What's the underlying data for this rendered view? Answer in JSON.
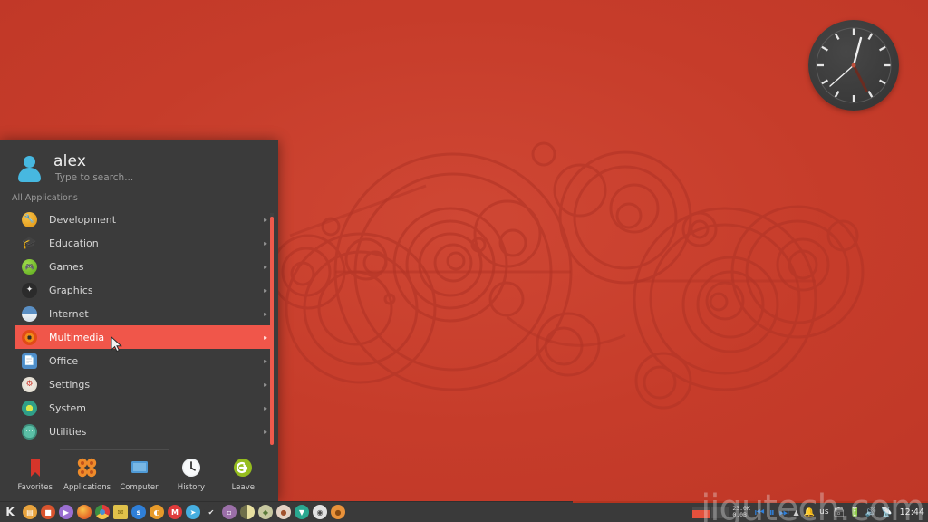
{
  "desktop": {
    "wallpaper_name": "gallifreyan-circles-wallpaper",
    "background_color": "#c8402e",
    "pattern_color": "#b8382a"
  },
  "clock_widget": {
    "name": "analog-clock-widget",
    "face_color": "#3b3b3b",
    "hand_color": "#e8e8e8",
    "second_hand_color": "#b03a2a",
    "time": "12:44"
  },
  "kickoff_menu": {
    "user": {
      "name": "alex",
      "search_placeholder": "Type to search..."
    },
    "section_label": "All Applications",
    "categories": [
      {
        "label": "Development",
        "icon": "development-icon",
        "arrow": "▸",
        "selected": false
      },
      {
        "label": "Education",
        "icon": "education-icon",
        "arrow": "▸",
        "selected": false
      },
      {
        "label": "Games",
        "icon": "games-icon",
        "arrow": "▸",
        "selected": false
      },
      {
        "label": "Graphics",
        "icon": "graphics-icon",
        "arrow": "▸",
        "selected": false
      },
      {
        "label": "Internet",
        "icon": "internet-icon",
        "arrow": "▸",
        "selected": false
      },
      {
        "label": "Multimedia",
        "icon": "multimedia-icon",
        "arrow": "▸",
        "selected": true
      },
      {
        "label": "Office",
        "icon": "office-icon",
        "arrow": "▸",
        "selected": false
      },
      {
        "label": "Settings",
        "icon": "settings-icon",
        "arrow": "▸",
        "selected": false
      },
      {
        "label": "System",
        "icon": "system-icon",
        "arrow": "▸",
        "selected": false
      },
      {
        "label": "Utilities",
        "icon": "utilities-icon",
        "arrow": "▸",
        "selected": false
      }
    ],
    "highlight_color": "#f0564a",
    "panel_color": "#3b3b3b",
    "tabs": [
      {
        "label": "Favorites",
        "icon": "bookmark-icon"
      },
      {
        "label": "Applications",
        "icon": "applications-grid-icon"
      },
      {
        "label": "Computer",
        "icon": "monitor-icon"
      },
      {
        "label": "History",
        "icon": "clock-icon"
      },
      {
        "label": "Leave",
        "icon": "power-logout-icon"
      }
    ],
    "active_tab": "Applications"
  },
  "taskbar": {
    "launcher": {
      "label": "K",
      "icon": "kde-kickoff-icon"
    },
    "launcher_icons": [
      {
        "name": "file-manager-icon",
        "glyph": "▤",
        "color": "#e8a33d",
        "active": false
      },
      {
        "name": "terminal-icon",
        "glyph": "■",
        "color": "#d9542e",
        "active": false
      },
      {
        "name": "media-player-icon",
        "glyph": "▶",
        "color": "#9b6fd1",
        "active": false
      },
      {
        "name": "firefox-icon",
        "glyph": "",
        "color": "#e8762c",
        "active": true
      },
      {
        "name": "chrome-icon",
        "glyph": "",
        "color": "#3d8f42",
        "active": false
      },
      {
        "name": "mail-client-icon",
        "glyph": "✉",
        "color": "#e0c14a",
        "active": false
      },
      {
        "name": "skype-icon",
        "glyph": "s",
        "color": "#2f7fd8",
        "active": false
      },
      {
        "name": "feed-reader-icon",
        "glyph": "◔",
        "color": "#e79a2a",
        "active": false
      },
      {
        "name": "gmail-icon",
        "glyph": "M",
        "color": "#e03b3b",
        "active": false
      },
      {
        "name": "telegram-icon",
        "glyph": "➤",
        "color": "#46aee0",
        "active": false
      },
      {
        "name": "checkmark-app-icon",
        "glyph": "✔",
        "color": "#3a3a3a",
        "active": false
      },
      {
        "name": "bitwarden-icon",
        "glyph": "□",
        "color": "#9b6fa8",
        "active": false
      },
      {
        "name": "contrast-app-icon",
        "glyph": "",
        "color": "#d8c96a",
        "active": false
      },
      {
        "name": "shield-app-icon",
        "glyph": "◆",
        "color": "#c8c8a0",
        "active": false
      },
      {
        "name": "coffee-app-icon",
        "glyph": "●",
        "color": "#d8c0b0",
        "active": false
      },
      {
        "name": "notes-app-icon",
        "glyph": "⬇",
        "color": "#2aa890",
        "active": false
      },
      {
        "name": "eye-app-icon",
        "glyph": "◉",
        "color": "#dcdcdc",
        "active": false
      },
      {
        "name": "paint-app-icon",
        "glyph": "●",
        "color": "#e9923a",
        "active": false
      }
    ],
    "tray": {
      "network_monitor": {
        "up": "23.0K",
        "down": "0.0B"
      },
      "media_prev": "⏮",
      "media_pause": "⏸",
      "media_next": "⏭",
      "show_hidden_arrow": "▲",
      "notifications_icon": "bell-icon",
      "keyboard_layout": "us",
      "clipboard_icon": "clipboard-icon",
      "battery_icon": "battery-icon",
      "volume_icon": "volume-icon",
      "network_icon": "network-icon",
      "clock": "12:44"
    }
  },
  "watermark": {
    "text": "jigutech.com"
  }
}
